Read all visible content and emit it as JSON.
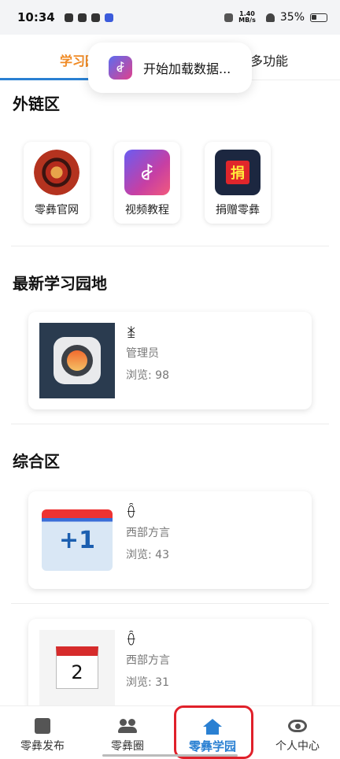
{
  "status_bar": {
    "time": "10:34",
    "net_speed_top": "1.40",
    "net_speed_bottom": "MB/s",
    "battery": "35%"
  },
  "tabs": {
    "active_label": "学习园",
    "other_label": "更多功能"
  },
  "toast": {
    "icon_text": "ꆀ",
    "message": "开始加载数据..."
  },
  "sections": {
    "links_title": "外链区",
    "latest_title": "最新学习园地",
    "general_title": "综合区"
  },
  "links": [
    {
      "label": "零彝官网",
      "icon": "official-site-icon"
    },
    {
      "label": "视频教程",
      "icon": "video-tutorial-icon",
      "icon_text": "ꆀ"
    },
    {
      "label": "捐赠零彝",
      "icon": "donate-icon",
      "icon_text": "捐"
    }
  ],
  "latest_cards": [
    {
      "title": "ꁧ",
      "author": "管理员",
      "views": "浏览: 98",
      "thumb": "camera-app-thumbnail"
    }
  ],
  "general_cards": [
    {
      "title": "ꂶ",
      "author": "西部方言",
      "views": "浏览: 43",
      "thumb": "calendar-plus-one-thumbnail",
      "thumb_text": "+1"
    },
    {
      "title": "ꂶ",
      "author": "西部方言",
      "views": "浏览: 31",
      "thumb": "calendar-day-two-thumbnail",
      "thumb_text": "2"
    }
  ],
  "bottom_nav": [
    {
      "label": "零彝发布",
      "icon": "publish-icon"
    },
    {
      "label": "零彝圈",
      "icon": "community-icon"
    },
    {
      "label": "零彝学园",
      "icon": "home-icon",
      "active": true
    },
    {
      "label": "个人中心",
      "icon": "eye-icon"
    }
  ],
  "colors": {
    "accent_blue": "#2a80d2",
    "active_tab_orange": "#f08a24",
    "highlight_red": "#e0202a"
  }
}
